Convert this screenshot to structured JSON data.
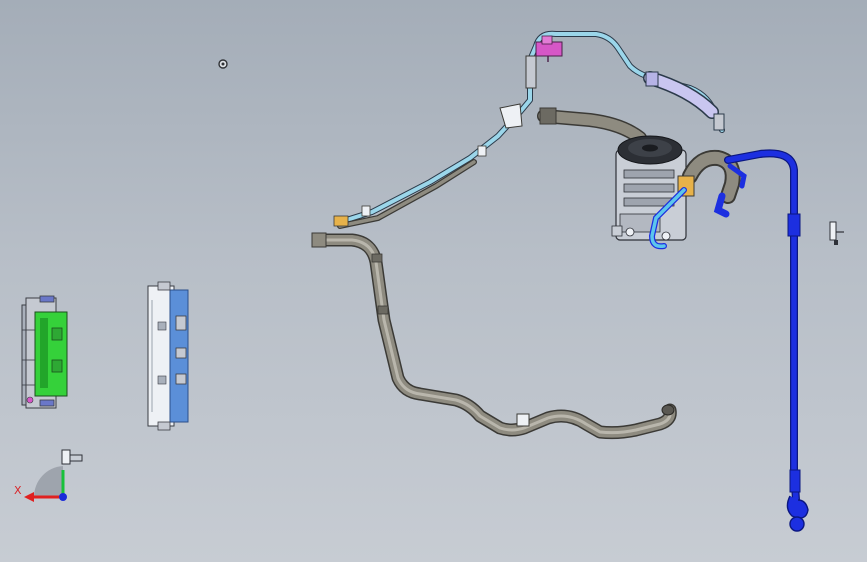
{
  "triad": {
    "x_label": "X",
    "x_color": "#e02020",
    "y_color": "#17c13a",
    "z_color": "#1a2bd9"
  },
  "colors": {
    "background_top": "#a4adb8",
    "background_bottom": "#c7ccd3",
    "suction_hose": "#8e8b80",
    "liquid_line": "#9bd6ea",
    "discharge_line": "#1c2fe0",
    "compressor_body": "#c9ced6",
    "compressor_pulley": "#2c2f35",
    "evaporator_core": "#35d13a",
    "condenser_side": "#5b8fd8",
    "pressure_switch": "#d657c7"
  }
}
